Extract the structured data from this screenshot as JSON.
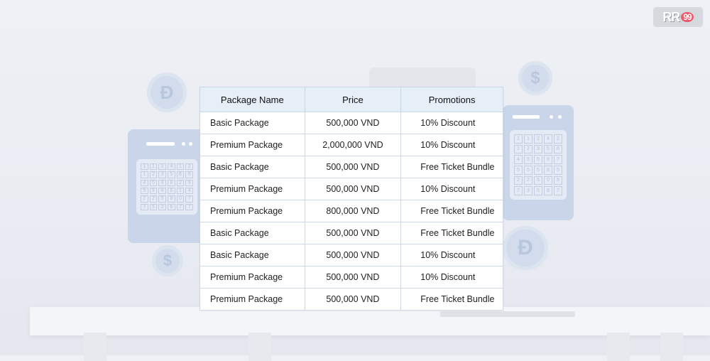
{
  "logo": {
    "text": "RR",
    "number": "99"
  },
  "table": {
    "headers": [
      "Package Name",
      "Price",
      "Promotions"
    ],
    "rows": [
      [
        "Basic Package",
        "500,000 VND",
        "10% Discount"
      ],
      [
        "Premium Package",
        "2,000,000 VND",
        "10% Discount"
      ],
      [
        "Basic Package",
        "500,000 VND",
        "Free Ticket Bundle"
      ],
      [
        "Premium Package",
        "500,000 VND",
        "10% Discount"
      ],
      [
        "Premium Package",
        "800,000 VND",
        "Free Ticket Bundle"
      ],
      [
        "Basic Package",
        "500,000 VND",
        "Free Ticket Bundle"
      ],
      [
        "Basic Package",
        "500,000 VND",
        "10% Discount"
      ],
      [
        "Premium Package",
        "500,000 VND",
        "10% Discount"
      ],
      [
        "Premium Package",
        "500,000 VND",
        "Free Ticket Bundle"
      ]
    ]
  },
  "decor": {
    "coin_dong": "Đ",
    "coin_dollar": "$"
  },
  "colors": {
    "header_bg": "#e6eef8",
    "decor_blue": "#c9d5e8",
    "background": "#eef0f5"
  }
}
